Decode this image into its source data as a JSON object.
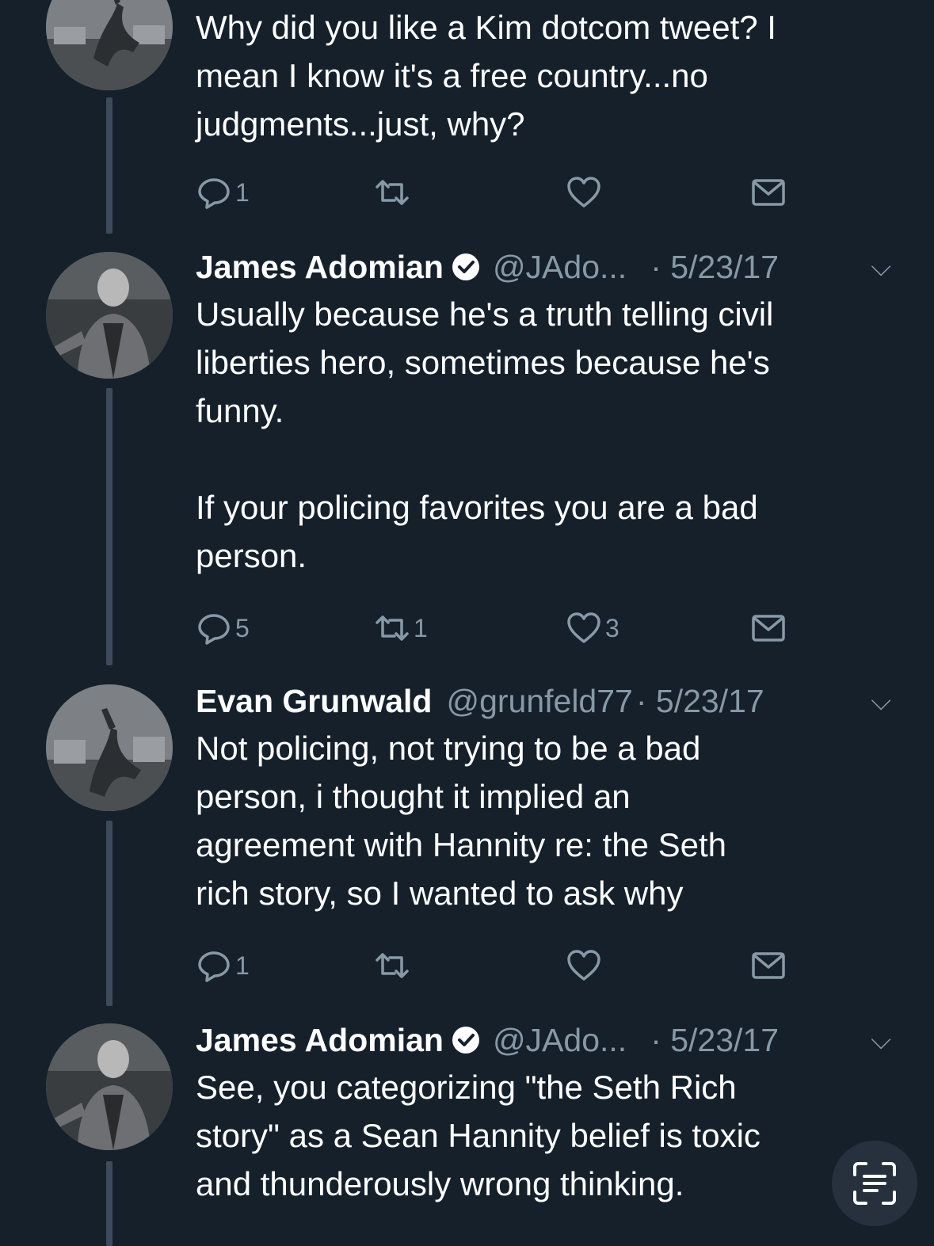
{
  "tweets": [
    {
      "name": "",
      "handle": "",
      "date": "",
      "text": "Why did you like a Kim dotcom tweet? I\nmean I know it's a free country...no\njudgments...just, why?",
      "replies": "1",
      "retweets": "",
      "likes": ""
    },
    {
      "name": "James Adomian",
      "handle": "@JAdo...",
      "date": "· 5/23/17",
      "text": "Usually because he's a truth telling civil\nliberties hero, sometimes because he's\nfunny.\n\nIf your policing favorites you are a bad\nperson.",
      "replies": "5",
      "retweets": "1",
      "likes": "3"
    },
    {
      "name": "Evan Grunwald",
      "handle": "@grunfeld77",
      "date": "· 5/23/17",
      "text": "Not policing, not trying to be a bad\nperson, i thought it implied an\nagreement with Hannity re: the Seth\nrich story, so I wanted to ask why",
      "replies": "1",
      "retweets": "",
      "likes": ""
    },
    {
      "name": "James Adomian",
      "handle": "@JAdo...",
      "date": "· 5/23/17",
      "text": "See, you categorizing \"the Seth Rich\nstory\" as a Sean Hannity belief is toxic\nand thunderously wrong thinking.",
      "replies": "",
      "retweets": "",
      "likes": ""
    }
  ],
  "icons": {
    "reply": "reply-icon",
    "retweet": "retweet-icon",
    "like": "heart-icon",
    "dm": "envelope-icon",
    "verified": "verified-badge-icon",
    "caret": "chevron-down-icon",
    "scan": "text-scan-icon"
  },
  "colors": {
    "background": "#15202b",
    "muted": "#8899a6",
    "thread_line": "#3c4a5a"
  }
}
